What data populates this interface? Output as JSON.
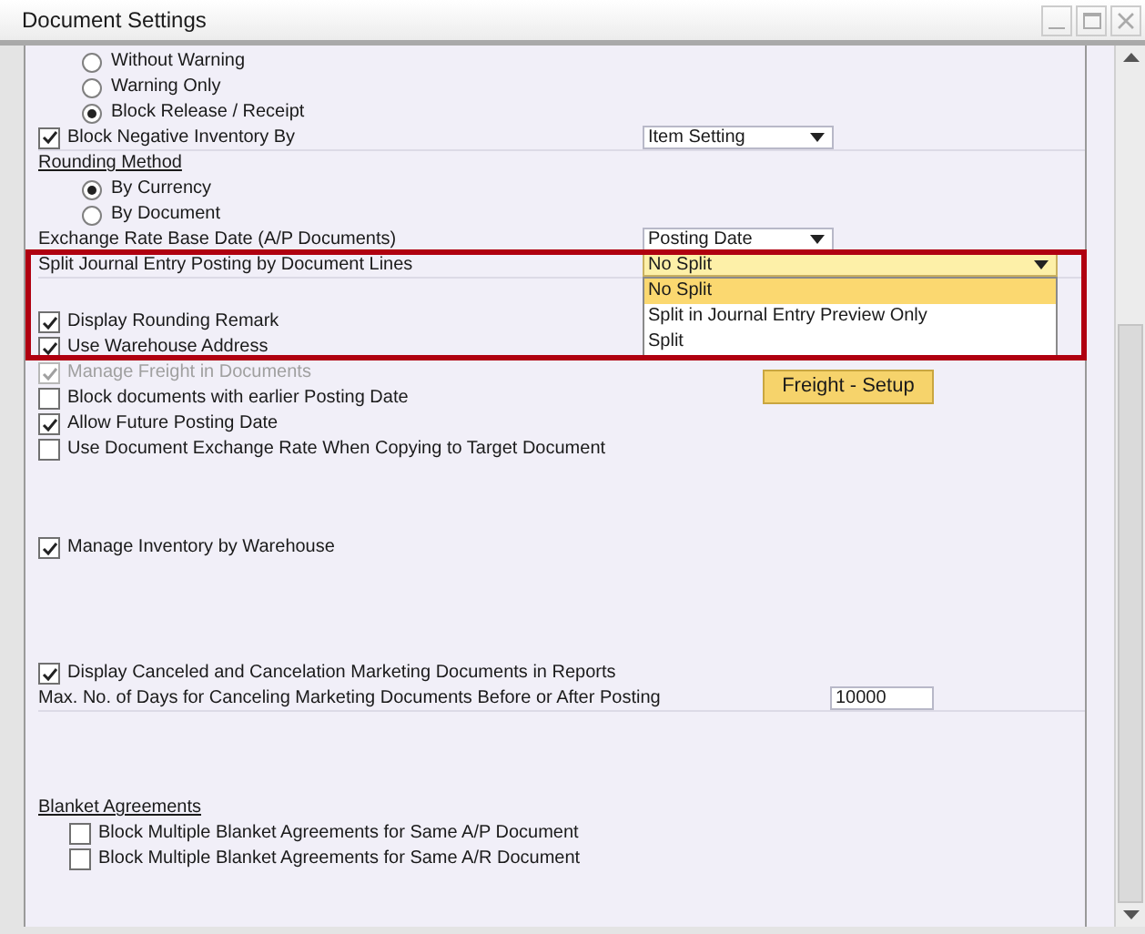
{
  "window": {
    "title": "Document Settings"
  },
  "sections": [
    {
      "rows": [
        {
          "kind": "radio_group",
          "options": [
            {
              "label": "Without Warning",
              "selected": false
            },
            {
              "label": "Warning Only",
              "selected": false
            },
            {
              "label": "Block Release / Receipt",
              "selected": true
            }
          ]
        },
        {
          "kind": "checkbox",
          "label": "Block Negative Inventory By",
          "checked": true,
          "disabled": false,
          "select": "Item Setting"
        },
        {
          "kind": "heading",
          "label": "Rounding Method"
        },
        {
          "kind": "radio_group",
          "options": [
            {
              "label": "By Currency",
              "selected": true
            },
            {
              "label": "By Document",
              "selected": false
            }
          ]
        },
        {
          "kind": "select",
          "label": "Exchange Rate Base Date (A/P Documents)",
          "value": "Posting Date",
          "open": false,
          "highlighted": false
        },
        {
          "kind": "select",
          "label": "Split Journal Entry Posting by Document Lines",
          "value": "No Split",
          "open": true,
          "highlighted": true,
          "options": [
            {
              "label": "No Split",
              "selected": true
            },
            {
              "label": "Split in Journal Entry Preview Only",
              "selected": false
            },
            {
              "label": "Split",
              "selected": false
            }
          ]
        }
      ]
    },
    {
      "rows": [
        {
          "kind": "checkbox",
          "label": "Display Rounding Remark",
          "checked": true,
          "disabled": false
        },
        {
          "kind": "checkbox",
          "label": "Use Warehouse Address",
          "checked": true,
          "disabled": false
        },
        {
          "kind": "checkbox",
          "label": "Manage Freight in Documents",
          "checked": true,
          "disabled": true,
          "button": "Freight - Setup"
        },
        {
          "kind": "checkbox",
          "label": "Block documents with earlier Posting Date",
          "checked": false,
          "disabled": false
        },
        {
          "kind": "checkbox",
          "label": "Allow Future Posting Date",
          "checked": true,
          "disabled": false
        },
        {
          "kind": "checkbox",
          "label": "Use Document Exchange Rate When Copying to Target Document",
          "checked": false,
          "disabled": false
        }
      ]
    },
    {
      "rows": [
        {
          "kind": "checkbox",
          "label": "Manage Inventory by Warehouse",
          "checked": true,
          "disabled": false
        }
      ]
    },
    {
      "rows": [
        {
          "kind": "checkbox",
          "label": "Display Canceled and Cancelation Marketing Documents in Reports",
          "checked": true,
          "disabled": false
        },
        {
          "kind": "field",
          "label": "Max. No. of Days for Canceling Marketing Documents Before or After Posting",
          "value": "10000"
        }
      ]
    },
    {
      "rows": [
        {
          "kind": "heading",
          "label": "Blanket Agreements"
        },
        {
          "kind": "checkbox",
          "label": "Block Multiple Blanket Agreements for Same A/P Document",
          "checked": false,
          "disabled": false,
          "indent": true
        },
        {
          "kind": "checkbox",
          "label": "Block Multiple Blanket Agreements for Same A/R Document",
          "checked": false,
          "disabled": false,
          "indent": true
        }
      ]
    }
  ]
}
